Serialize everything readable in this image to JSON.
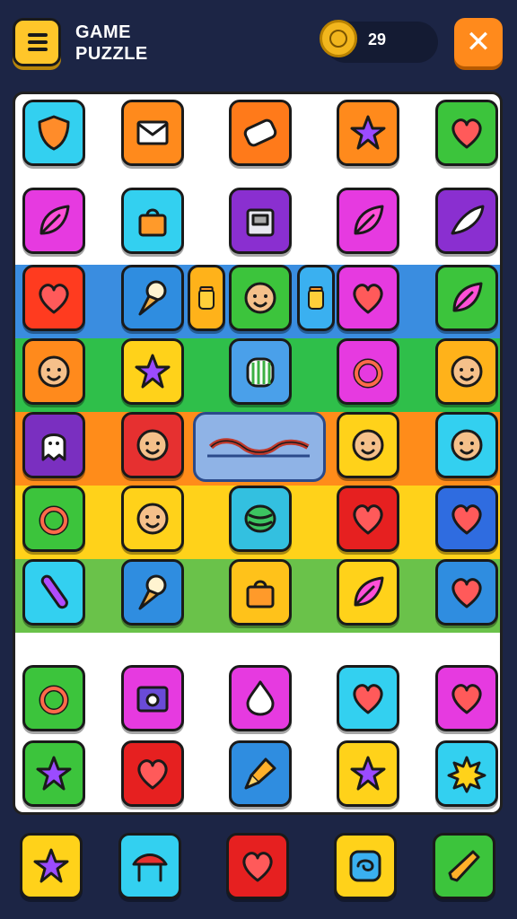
{
  "header": {
    "menu_icon": "hamburger-menu-icon",
    "title_line1": "GAME",
    "title_line2": "PUZZLE",
    "coin_icon": "coin-icon",
    "coin_count": "29",
    "close_icon": "close-icon"
  },
  "board": {
    "bands": [
      "#3a8de0",
      "#2fbf4a",
      "#ff8c1a",
      "#ffd21a",
      "#6ac24a"
    ],
    "rows": [
      [
        {
          "icon": "shield-icon",
          "bg": "#33d0f0"
        },
        {
          "icon": "envelope-icon",
          "bg": "#ff8a1c"
        },
        {
          "icon": "bandage-icon",
          "bg": "#ff7a1a"
        },
        {
          "icon": "star-icon",
          "bg": "#ff8a1c"
        },
        {
          "icon": "heart-icon",
          "bg": "#3cc43c"
        }
      ],
      [
        {
          "icon": "leaf-icon",
          "bg": "#e63ae0"
        },
        {
          "icon": "bag-icon",
          "bg": "#33d0f0"
        },
        {
          "icon": "box-icon",
          "bg": "#8a2fd0"
        },
        {
          "icon": "leaf-icon",
          "bg": "#e63ae0"
        },
        {
          "icon": "feather-icon",
          "bg": "#8a2fd0"
        }
      ],
      [
        {
          "icon": "heart-icon",
          "bg": "#ff3b1f"
        },
        {
          "icon": "ice-cream-icon",
          "bg": "#2f8de0"
        },
        {
          "icon": "jar-icon",
          "bg": "#ffb21a"
        },
        {
          "icon": "face-icon",
          "bg": "#3cc43c"
        },
        {
          "icon": "jar-icon",
          "bg": "#3ab0f0"
        },
        {
          "icon": "heart-icon",
          "bg": "#e63ae0"
        },
        {
          "icon": "leaf-icon",
          "bg": "#3cc43c"
        }
      ],
      [
        {
          "icon": "face-icon",
          "bg": "#ff8a1c"
        },
        {
          "icon": "star-icon",
          "bg": "#ffd21a"
        },
        {
          "icon": "gate-icon",
          "bg": "#4aa0ea"
        },
        {
          "icon": "ring-icon",
          "bg": "#e63ae0"
        },
        {
          "icon": "face-icon",
          "bg": "#ffb21a"
        }
      ],
      [
        {
          "icon": "ghost-icon",
          "bg": "#7a2fc0"
        },
        {
          "icon": "face-icon",
          "bg": "#e63030"
        },
        {
          "icon": "face-icon",
          "bg": "#ffd21a"
        },
        {
          "icon": "face-icon",
          "bg": "#33d0f0"
        }
      ],
      [
        {
          "icon": "ring-icon",
          "bg": "#3cc43c"
        },
        {
          "icon": "face-icon",
          "bg": "#ffd21a"
        },
        {
          "icon": "ball-icon",
          "bg": "#33c0e0"
        },
        {
          "icon": "heart-icon",
          "bg": "#e62020"
        },
        {
          "icon": "heart-icon",
          "bg": "#2f6ce0"
        }
      ],
      [
        {
          "icon": "candy-icon",
          "bg": "#33d0f0"
        },
        {
          "icon": "ice-cream-icon",
          "bg": "#2f8de0"
        },
        {
          "icon": "bag-icon",
          "bg": "#ffc21a"
        },
        {
          "icon": "leaf-icon",
          "bg": "#ffd21a"
        },
        {
          "icon": "heart-icon",
          "bg": "#2f8de0"
        }
      ],
      [
        {
          "icon": "ring-icon",
          "bg": "#3cc43c"
        },
        {
          "icon": "camera-icon",
          "bg": "#e63ae0"
        },
        {
          "icon": "drop-icon",
          "bg": "#e63ae0"
        },
        {
          "icon": "heart-icon",
          "bg": "#33d0f0"
        },
        {
          "icon": "heart-icon",
          "bg": "#e63ae0"
        }
      ],
      [
        {
          "icon": "star-icon",
          "bg": "#3cc43c"
        },
        {
          "icon": "heart-icon",
          "bg": "#e62020"
        },
        {
          "icon": "brush-icon",
          "bg": "#2f8de0"
        },
        {
          "icon": "star-icon",
          "bg": "#ffd21a"
        },
        {
          "icon": "burst-icon",
          "bg": "#33d0f0"
        }
      ]
    ],
    "special_tile": {
      "icon": "bone-chain-icon",
      "bg": "#8fb3e6"
    }
  },
  "tray": [
    {
      "icon": "star-icon",
      "bg": "#ffd21a"
    },
    {
      "icon": "tent-icon",
      "bg": "#33d0f0"
    },
    {
      "icon": "heart-icon",
      "bg": "#e62020"
    },
    {
      "icon": "swirl-icon",
      "bg": "#ffd21a"
    },
    {
      "icon": "carrot-icon",
      "bg": "#3cc43c"
    }
  ]
}
